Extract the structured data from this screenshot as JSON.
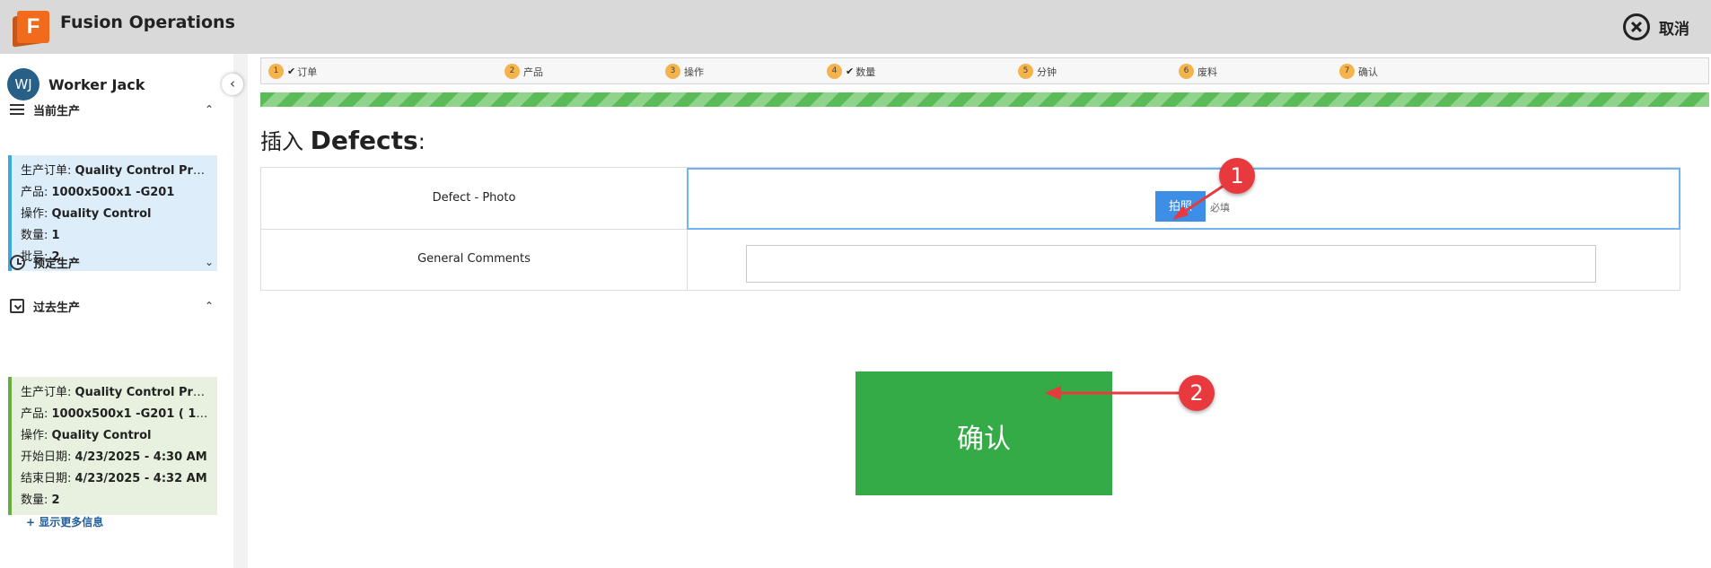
{
  "app": {
    "title": "Fusion Operations",
    "logo_letter": "F",
    "cancel_label": "取消"
  },
  "user": {
    "initials": "WJ",
    "name": "Worker Jack"
  },
  "sidebar": {
    "current": {
      "title": "当前生产",
      "rows": [
        {
          "label": "生产订单: ",
          "value": "Quality Control Prod..."
        },
        {
          "label": "产品: ",
          "value": "1000x500x1 -G201"
        },
        {
          "label": "操作: ",
          "value": "Quality Control"
        },
        {
          "label": "数量: ",
          "value": "1"
        },
        {
          "label": "批号: ",
          "value": "2"
        }
      ]
    },
    "scheduled": {
      "title": "预定生产"
    },
    "past": {
      "title": "过去生产",
      "rows": [
        {
          "label": "生产订单: ",
          "value": "Quality Control Prod..."
        },
        {
          "label": "产品: ",
          "value": "1000x500x1 -G201 ( 100..."
        },
        {
          "label": "操作: ",
          "value": "Quality Control"
        },
        {
          "label": "开始日期: ",
          "value": "4/23/2025 - 4:30 AM"
        },
        {
          "label": "结束日期: ",
          "value": "4/23/2025 - 4:32 AM"
        },
        {
          "label": "数量: ",
          "value": "2"
        }
      ],
      "more_label": "+  显示更多信息"
    }
  },
  "steps": [
    {
      "num": "1",
      "label": "订单",
      "checked": true
    },
    {
      "num": "2",
      "label": "产品",
      "checked": false
    },
    {
      "num": "3",
      "label": "操作",
      "checked": false
    },
    {
      "num": "4",
      "label": "数量",
      "checked": true
    },
    {
      "num": "5",
      "label": "分钟",
      "checked": false
    },
    {
      "num": "6",
      "label": "废料",
      "checked": false
    },
    {
      "num": "7",
      "label": "确认",
      "checked": false
    }
  ],
  "progress": 1.0,
  "heading": {
    "prefix": "插入 ",
    "name": "Defects",
    "suffix": ":"
  },
  "form": {
    "photo_label": "Defect - Photo",
    "photo_button": "拍照",
    "required": "必填",
    "comments_label": "General Comments",
    "comments_value": ""
  },
  "confirm_label": "确认",
  "annotations": [
    "1",
    "2"
  ],
  "colors": {
    "accent_green": "#35ab48",
    "photo_button": "#3d8ee6",
    "callout": "#e8393f",
    "step_badge": "#f5b34c"
  }
}
